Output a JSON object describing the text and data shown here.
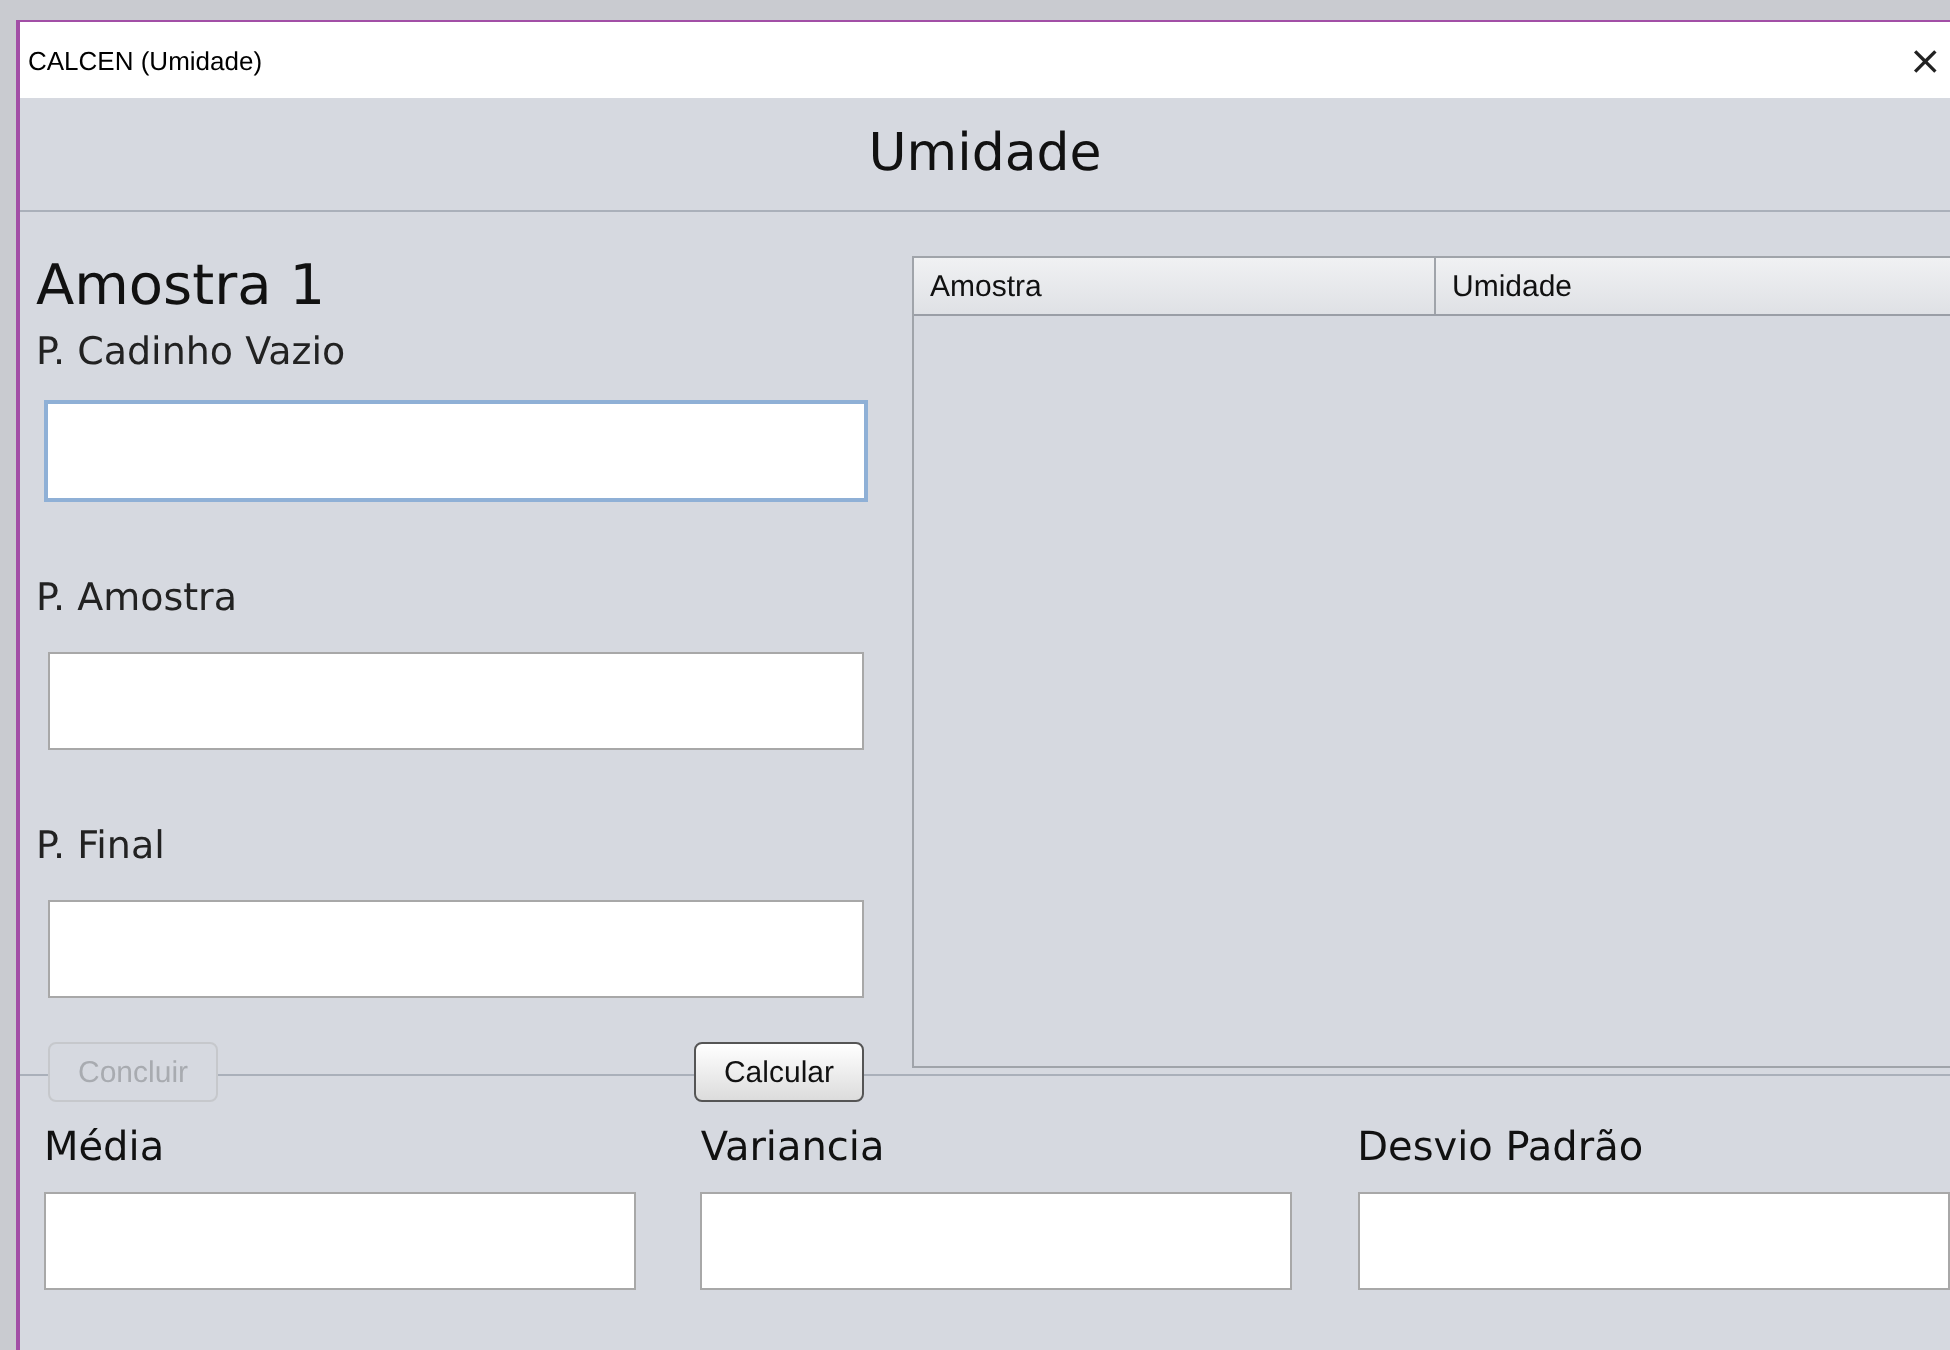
{
  "window": {
    "title": "CALCEN (Umidade)",
    "close": "×"
  },
  "header": "Umidade",
  "sample": {
    "title": "Amostra 1",
    "fields": [
      {
        "label": "P. Cadinho Vazio",
        "focused": true
      },
      {
        "label": "P. Amostra",
        "focused": false
      },
      {
        "label": "P. Final",
        "focused": false
      }
    ]
  },
  "buttons": [
    {
      "label": "Concluir",
      "disabled": true
    },
    {
      "label": "Calcular",
      "disabled": false
    }
  ],
  "table": {
    "columns": [
      "Amostra",
      "Umidade"
    ]
  },
  "stats": [
    {
      "label": "Média"
    },
    {
      "label": "Variancia"
    },
    {
      "label": "Desvio Padrão"
    }
  ]
}
